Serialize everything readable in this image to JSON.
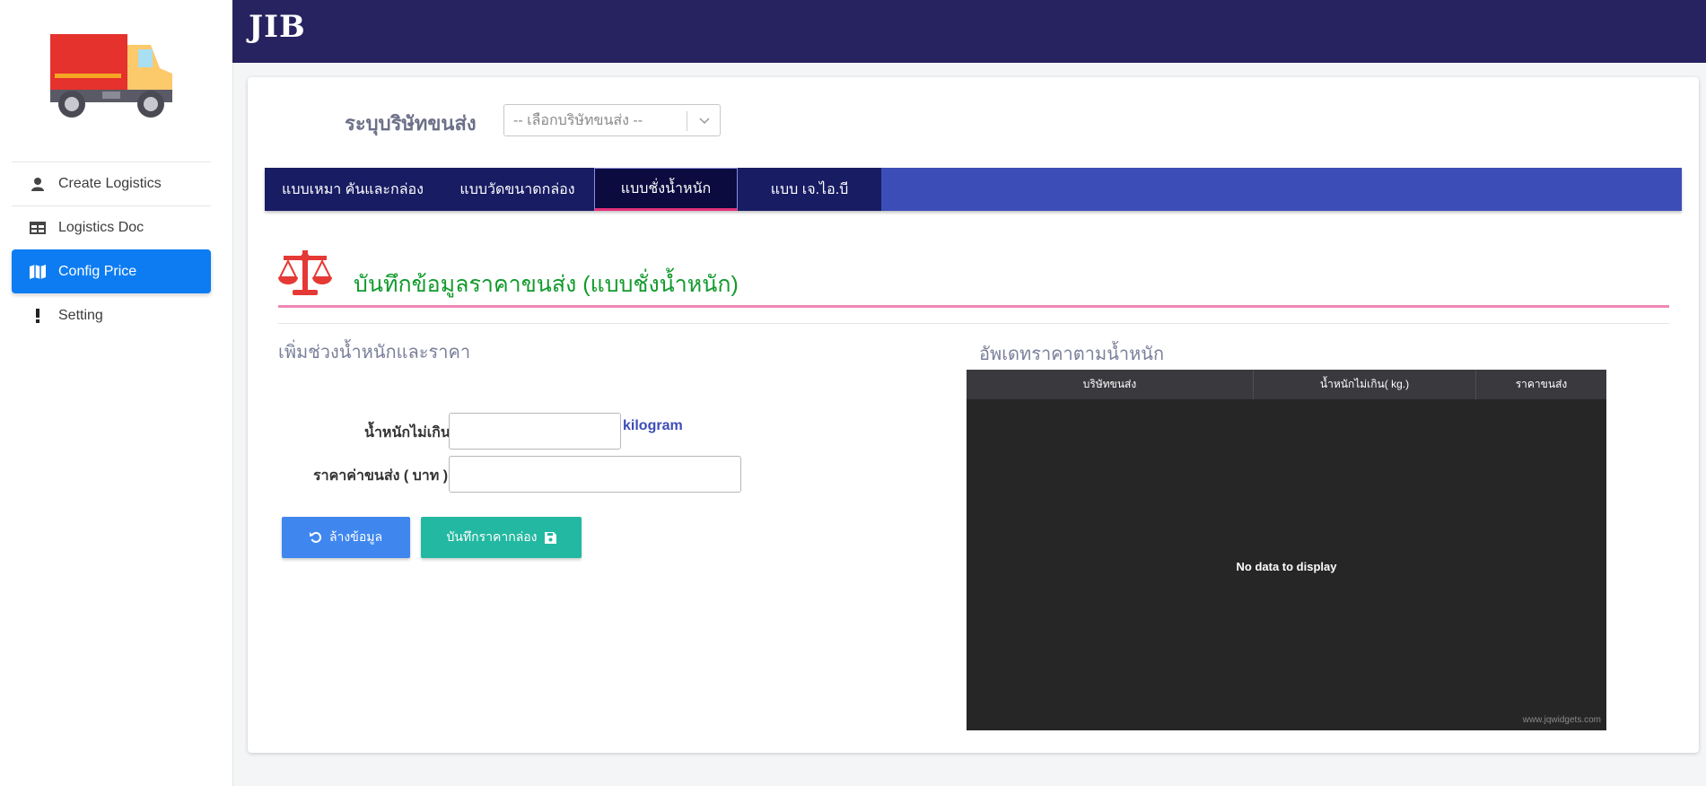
{
  "app": {
    "logo_text": "JIB"
  },
  "sidebar": {
    "items": [
      {
        "label": "Create Logistics",
        "icon": "user-icon",
        "active": false
      },
      {
        "label": "Logistics Doc",
        "icon": "table-icon",
        "active": false
      },
      {
        "label": "Config Price",
        "icon": "map-icon",
        "active": true
      },
      {
        "label": "Setting",
        "icon": "exclamation-icon",
        "active": false
      }
    ]
  },
  "company": {
    "label": "ระบุบริษัทขนส่ง",
    "select_value": "-- เลือกบริษัทขนส่ง --"
  },
  "tabs": [
    {
      "label": "แบบเหมา คันและกล่อง",
      "active": false
    },
    {
      "label": "แบบวัดขนาดกล่อง",
      "active": false
    },
    {
      "label": "แบบชั่งน้ำหนัก",
      "active": true
    },
    {
      "label": "แบบ เจ.ไอ.บี",
      "active": false
    }
  ],
  "section": {
    "title": "บันทึกข้อมูลราคาขนส่ง (แบบชั่งน้ำหนัก)",
    "left_subtitle": "เพิ่มช่วงน้ำหนักและราคา",
    "right_subtitle": "อัพเดทราคาตามน้ำหนัก"
  },
  "form": {
    "weight_label": "น้ำหนักไม่เกิน",
    "weight_value": "",
    "weight_unit": "kilogram",
    "price_label": "ราคาค่าขนส่ง ( บาท )",
    "price_value": "",
    "clear_button": "ล้างข้อมูล",
    "save_button": "บันทึกราคากล่อง"
  },
  "grid": {
    "columns": [
      "บริษัทขนส่ง",
      "น้ำหนักไม่เกิน( kg.)",
      "ราคาขนส่ง"
    ],
    "rows": [],
    "empty_text": "No data to display",
    "watermark": "www.jqwidgets.com"
  },
  "colors": {
    "topbar": "#272361",
    "tab_bar": "#3d4db7",
    "tab_bg": "#181c63",
    "active_nav": "#0d7cf2",
    "title_green": "#119a2c",
    "accent_pink": "#f087b5",
    "btn_clear": "#3f87ef",
    "btn_save": "#23b8a2",
    "scale_icon": "#e53935"
  }
}
